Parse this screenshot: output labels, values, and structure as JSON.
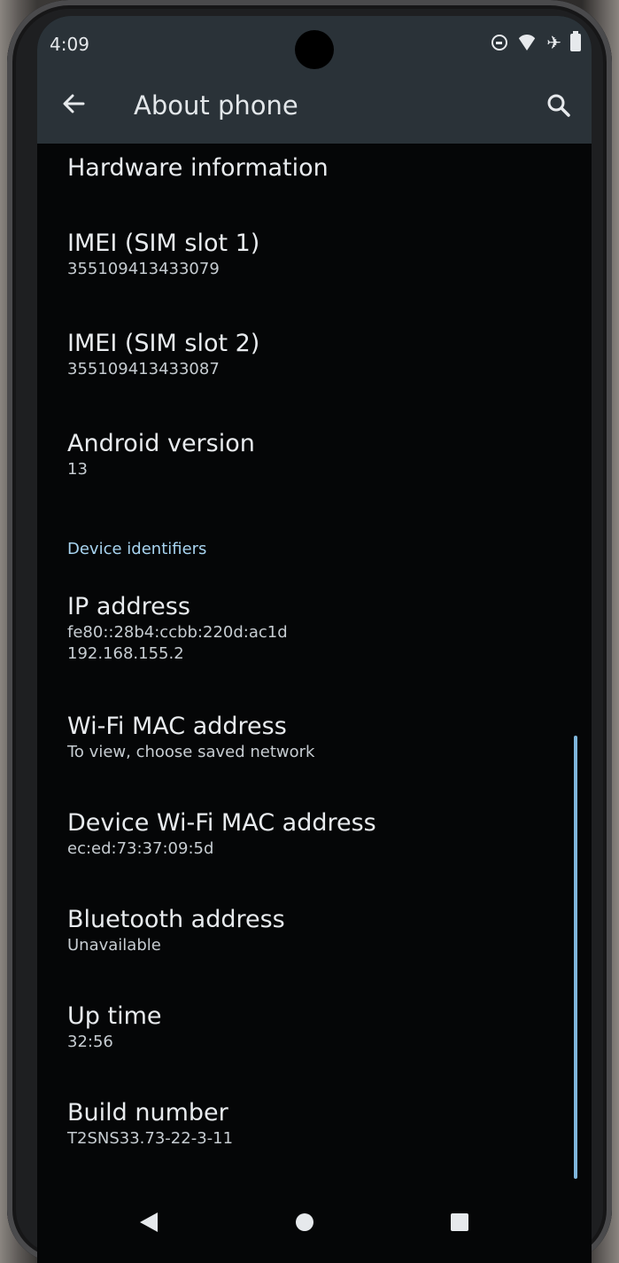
{
  "status_bar": {
    "time": "4:09",
    "icons": [
      "do-not-disturb-icon",
      "wifi-icon",
      "airplane-icon",
      "battery-icon"
    ]
  },
  "app_bar": {
    "title": "About phone",
    "back_icon": "arrow-back-icon",
    "search_icon": "search-icon"
  },
  "items": [
    {
      "title": "Hardware information",
      "subtitle": ""
    },
    {
      "title": "IMEI (SIM slot 1)",
      "subtitle": "355109413433079"
    },
    {
      "title": "IMEI (SIM slot 2)",
      "subtitle": "355109413433087"
    },
    {
      "title": "Android version",
      "subtitle": "13"
    }
  ],
  "device_identifiers": {
    "header": "Device identifiers",
    "items": [
      {
        "title": "IP address",
        "subtitle": "fe80::28b4:ccbb:220d:ac1d",
        "subtitle2": "192.168.155.2"
      },
      {
        "title": "Wi-Fi MAC address",
        "subtitle": "To view, choose saved network"
      },
      {
        "title": "Device Wi-Fi MAC address",
        "subtitle": "ec:ed:73:37:09:5d"
      },
      {
        "title": "Bluetooth address",
        "subtitle": "Unavailable"
      },
      {
        "title": "Up time",
        "subtitle": "32:56"
      },
      {
        "title": "Build number",
        "subtitle": "T2SNS33.73-22-3-11"
      }
    ]
  },
  "nav_bar": {
    "back_icon": "nav-back-triangle-icon",
    "home_icon": "nav-home-circle-icon",
    "recents_icon": "nav-recents-square-icon"
  },
  "colors": {
    "app_bar_bg": "#2a3238",
    "background": "#050607",
    "accent": "#a8d4f0"
  }
}
